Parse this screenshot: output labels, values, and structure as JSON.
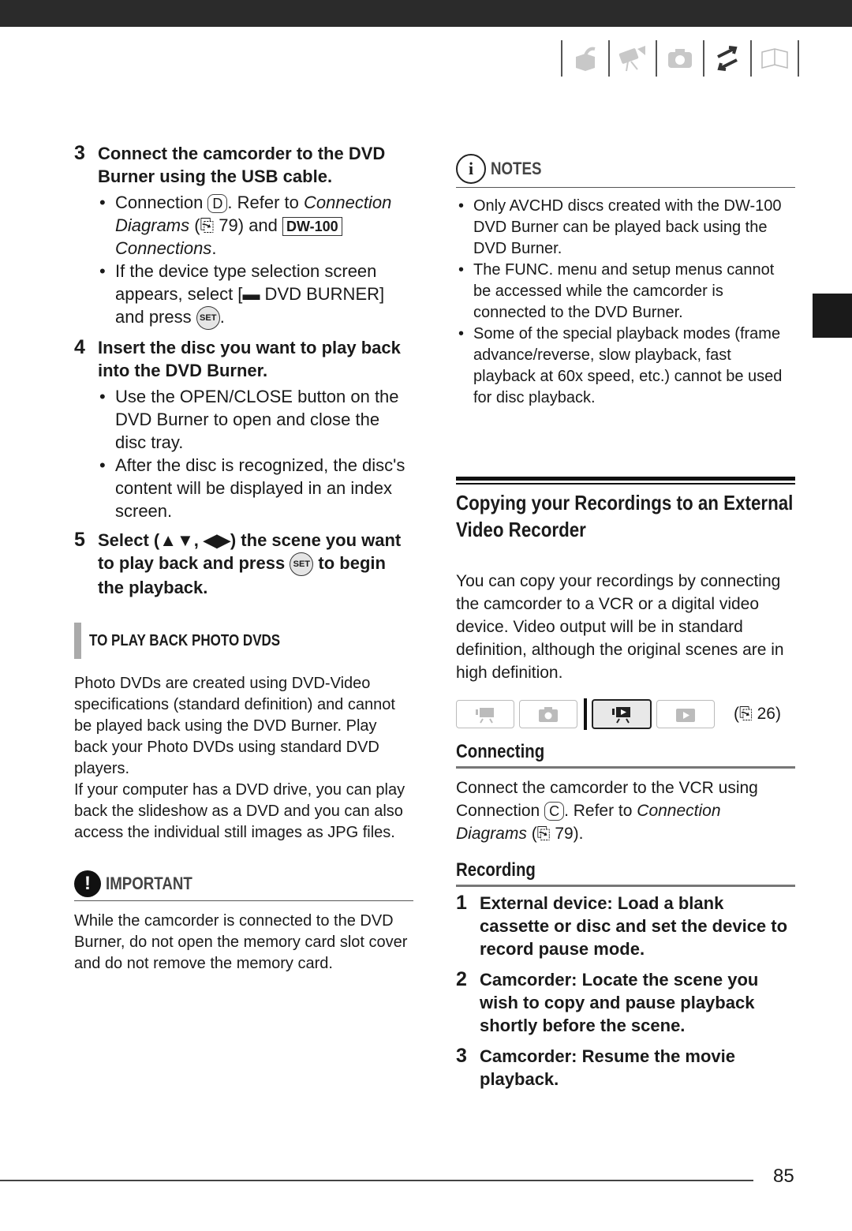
{
  "header": {
    "nav_icons": [
      "box-arrow-icon",
      "camcorder-icon",
      "camera-icon",
      "transfer-arrows-icon",
      "book-icon"
    ]
  },
  "left": {
    "step3": {
      "num": "3",
      "title": "Connect the camcorder to the DVD Burner using the USB cable.",
      "b1_pre": "Connection ",
      "b1_conn": "D",
      "b1_mid": ". Refer to ",
      "b1_ital": "Connection Diagrams",
      "b1_ref": " (⎘ 79) and ",
      "b1_tag": "DW-100",
      "b1_ital2": " Connections",
      "b1_end": ".",
      "b2_pre": "If the device type selection screen appears, select [",
      "b2_item": " DVD BURNER]",
      "b2_mid": " and press ",
      "b2_set": "SET",
      "b2_end": "."
    },
    "step4": {
      "num": "4",
      "title": "Insert the disc you want to play back into the DVD Burner.",
      "bullets": [
        "Use the OPEN/CLOSE button on the DVD Burner to open and close the disc tray.",
        "After the disc is recognized, the disc's content will be displayed in an index screen."
      ]
    },
    "step5": {
      "num": "5",
      "pre": "Select (▲▼, ◀▶) the scene you want to play back and press ",
      "set": "SET",
      "post": " to begin the playback."
    },
    "subhead": "TO PLAY BACK PHOTO DVDS",
    "para1": "Photo DVDs are created using DVD-Video specifications (standard definition) and cannot be played back using the DVD Burner. Play back your Photo DVDs using standard DVD players.",
    "para2": "If your computer has a DVD drive, you can play back the slideshow as a DVD and you can also access the individual still images as JPG files.",
    "important_label": "IMPORTANT",
    "important_text": "While the camcorder is connected to the DVD Burner, do not open the memory card slot cover and do not remove the memory card."
  },
  "right": {
    "notes_label": "NOTES",
    "notes": [
      "Only AVCHD discs created with the DW-100 DVD Burner can be played back using the DVD Burner.",
      "The FUNC. menu and setup menus cannot be accessed while the camcorder is connected to the DVD Burner.",
      "Some of the special playback modes (frame advance/reverse, slow playback, fast playback at 60x speed, etc.) cannot be used for disc playback."
    ],
    "section_title": "Copying your Recordings to an External Video Recorder",
    "intro": "You can copy your recordings by connecting the camcorder to a VCR or a digital video device. Video output will be in standard definition, although the original scenes are in high definition.",
    "modes": [
      {
        "icon": "movie-record-icon",
        "active": false
      },
      {
        "icon": "photo-record-icon",
        "active": false
      },
      {
        "icon": "movie-playback-icon",
        "active": true
      },
      {
        "icon": "photo-playback-icon",
        "active": false
      }
    ],
    "mode_ref": "(⎘ 26)",
    "connecting_title": "Connecting",
    "connecting_pre": "Connect the camcorder to the VCR using Connection ",
    "connecting_conn": "C",
    "connecting_mid": ". Refer to ",
    "connecting_ital": "Connection Diagrams",
    "connecting_end": " (⎘ 79).",
    "recording_title": "Recording",
    "steps": [
      {
        "num": "1",
        "text": "External device: Load a blank cassette or disc and set the device to record pause mode."
      },
      {
        "num": "2",
        "text": "Camcorder: Locate the scene you wish to copy and pause playback shortly before the scene."
      },
      {
        "num": "3",
        "text": "Camcorder: Resume the movie playback."
      }
    ]
  },
  "footer": {
    "page": "85"
  }
}
